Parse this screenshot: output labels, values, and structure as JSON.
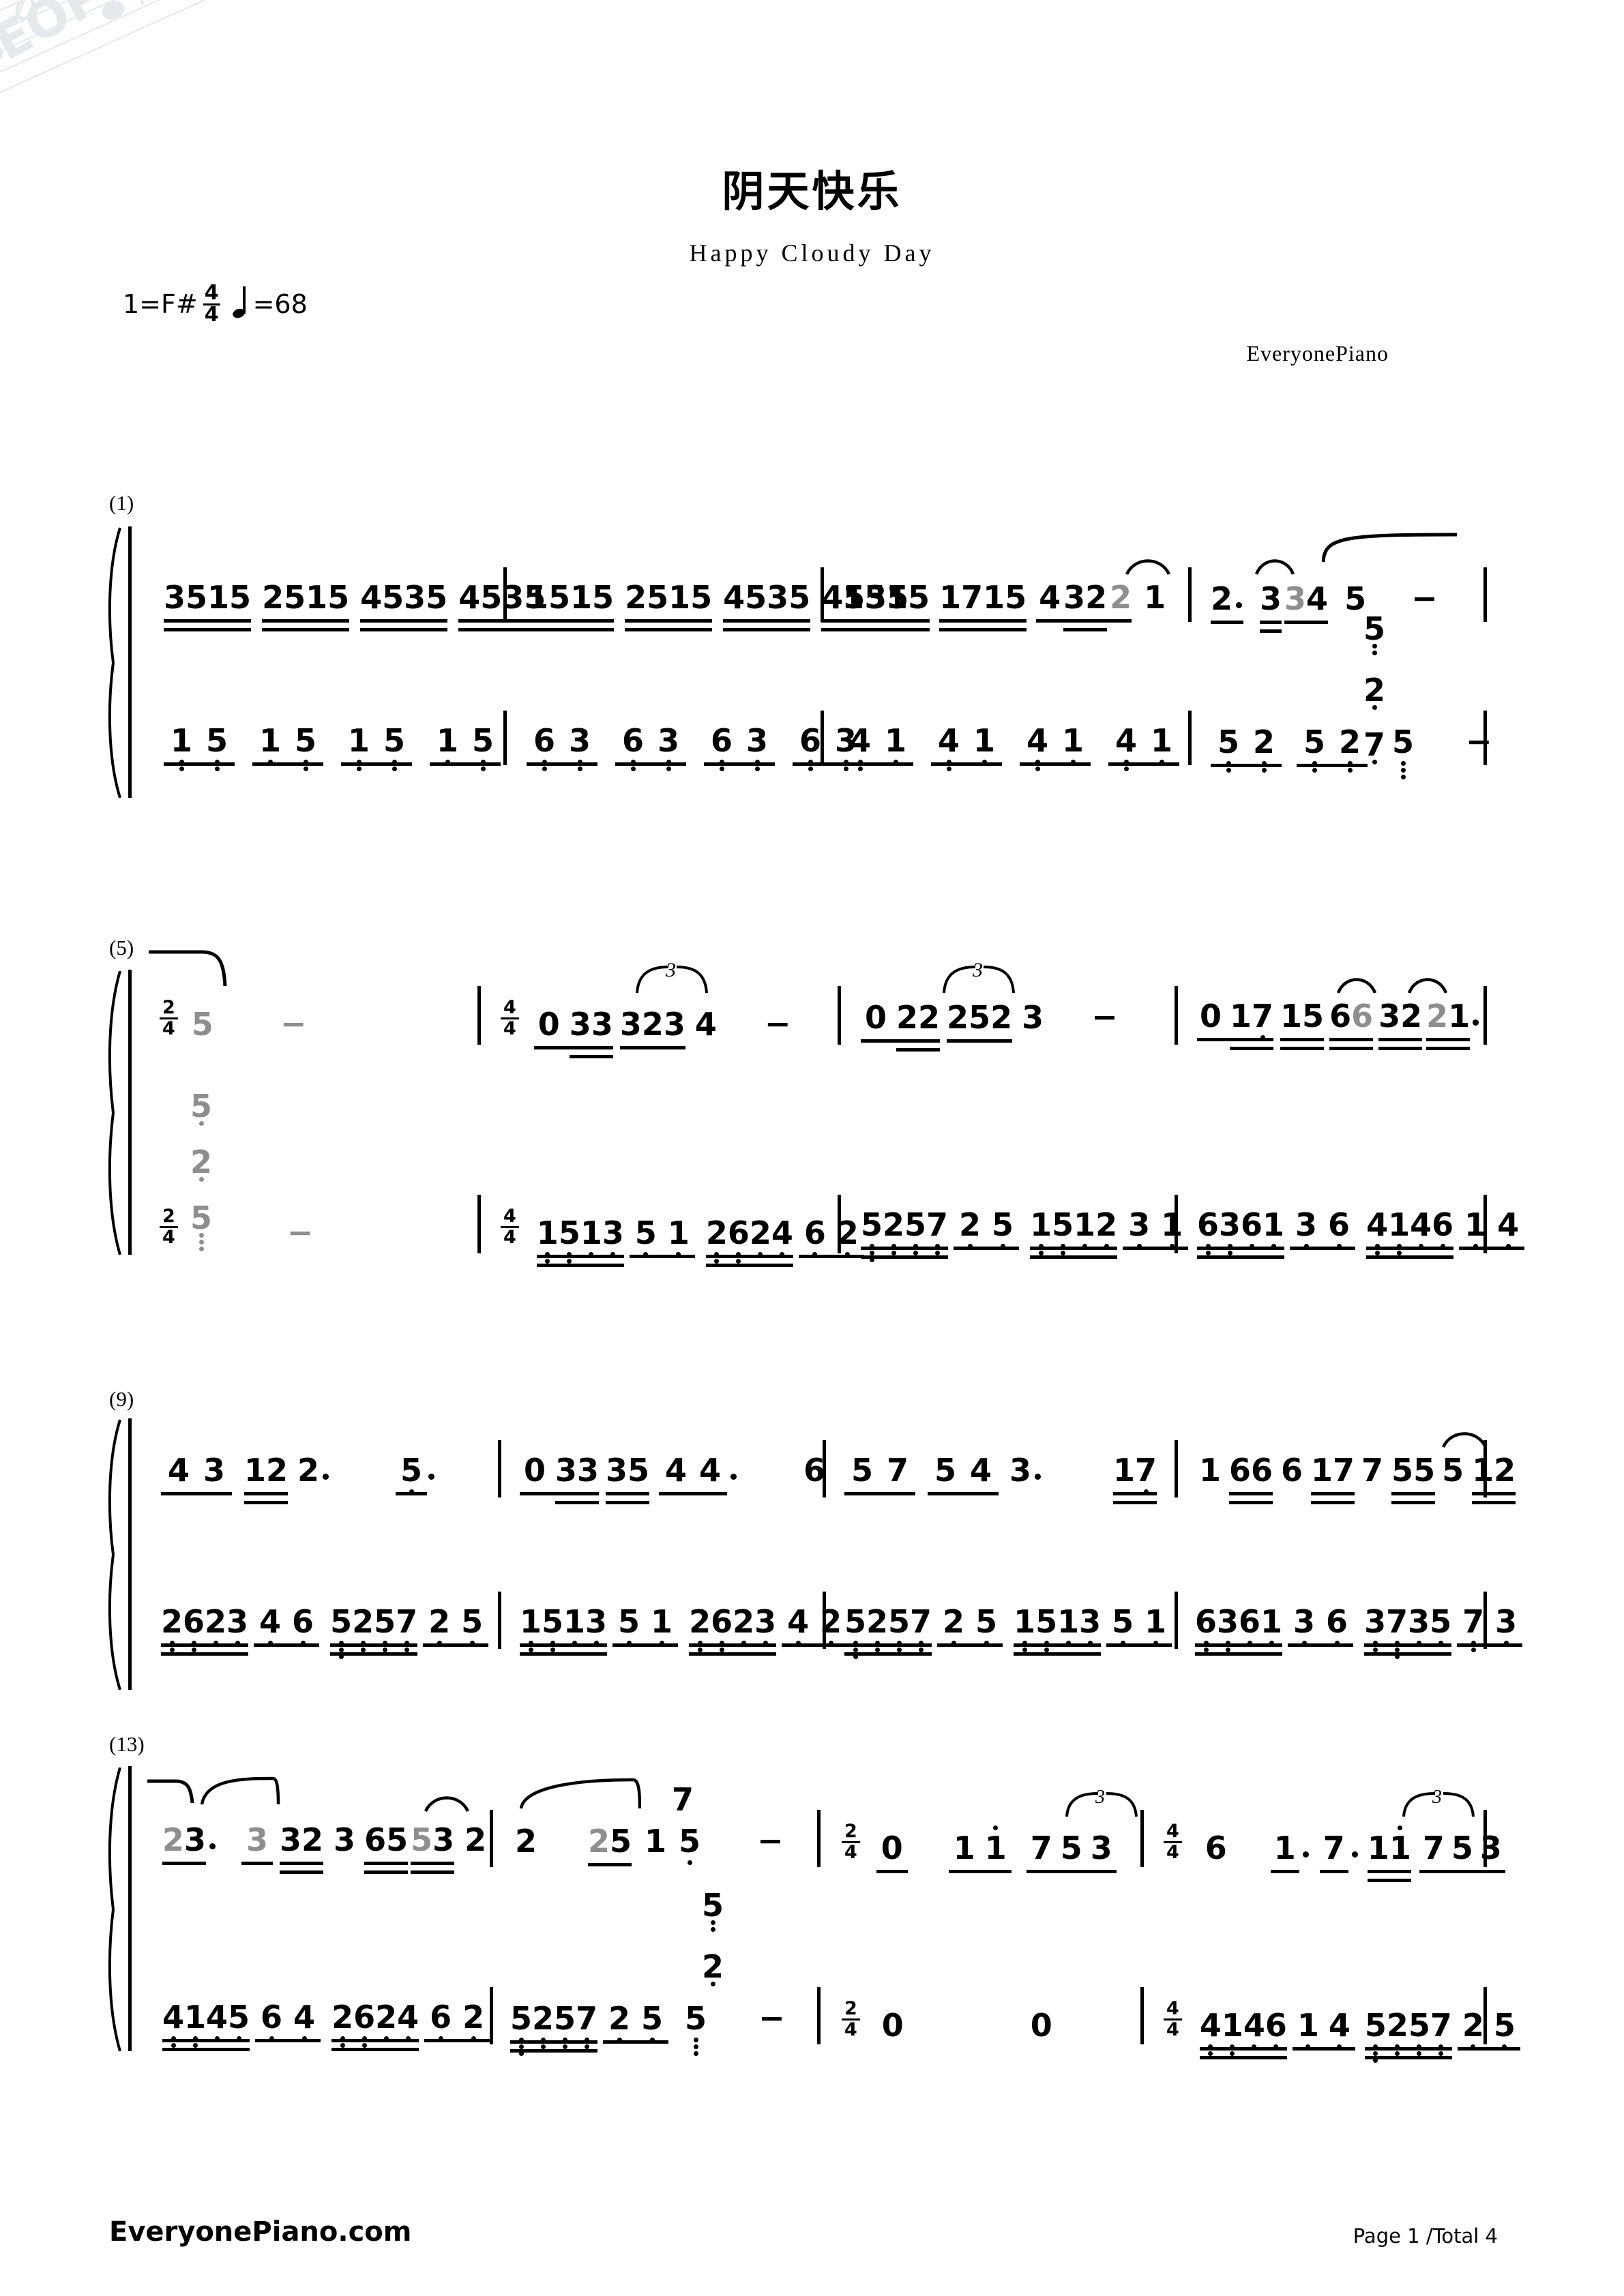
{
  "meta": {
    "title": "阴天快乐",
    "subtitle": "Happy Cloudy Day",
    "key": "1=F#",
    "time_signature": {
      "num": "4",
      "den": "4"
    },
    "tempo_label": "=68",
    "tempo_value": "68",
    "author": "EveryonePiano",
    "watermark": "EOP"
  },
  "footer": {
    "site": "EveryonePiano.com",
    "page": "Page 1 /Total 4"
  },
  "systems": [
    {
      "number": "(1)",
      "treble_measures": [
        {
          "text": "3515 2515 4535 4535"
        },
        {
          "text": "1515 2515 4535 4535"
        },
        {
          "text": "1515 1715 4 32 2 1"
        },
        {
          "text": "2· 3 3 4 5 −"
        }
      ],
      "bass_measures": [
        {
          "text": "1 5 1 5 1 5 1 5"
        },
        {
          "text": "6 3 6 3 6 3 6 3"
        },
        {
          "text": "4 1 4 1 4 1 4 1"
        },
        {
          "text": "5 2 5 2 5 − (chord 5/2/5)"
        }
      ]
    },
    {
      "number": "(5)",
      "treble_measures": [
        {
          "text": "2/4 5 −"
        },
        {
          "text": "4/4 0 33 323 4 −"
        },
        {
          "text": "0 22 252 3 −"
        },
        {
          "text": "0 17 15 6 6 32 21·"
        }
      ],
      "bass_measures": [
        {
          "text": "2/4 chord 5/2/5 −"
        },
        {
          "text": "4/4 1513 5 1  2624 6 2"
        },
        {
          "text": "5257 2 5  1512 3 1"
        },
        {
          "text": "6361 3 6  4146 1 4"
        }
      ]
    },
    {
      "number": "(9)",
      "treble_measures": [
        {
          "text": "4 3 12 2· 5·"
        },
        {
          "text": "0 33 35 4 4· 6"
        },
        {
          "text": "5 7 5 4 3· 17"
        },
        {
          "text": "1 66 6 17 7 55 5 12"
        }
      ],
      "bass_measures": [
        {
          "text": "2623 4 6  5257 2 5"
        },
        {
          "text": "1513 5 1  2623 4 2"
        },
        {
          "text": "5257 2 5  1513 5 1"
        },
        {
          "text": "6361 3 6  3735 7 3"
        }
      ]
    },
    {
      "number": "(13)",
      "treble_measures": [
        {
          "text": "23· 3 32 3 65 53 2"
        },
        {
          "text": "2 25 1 5(7) −"
        },
        {
          "text": "2/4 0 1 i 7 5 3"
        },
        {
          "text": "4/4 6 1· 7· 1i 7 5 3"
        }
      ],
      "bass_measures": [
        {
          "text": "4145 6 4  2624 6 2"
        },
        {
          "text": "5257 2 5  chord 5/2/5 −"
        },
        {
          "text": "2/4 0   0"
        },
        {
          "text": "4/4 4146 1 4  5257 2 5"
        }
      ]
    }
  ]
}
